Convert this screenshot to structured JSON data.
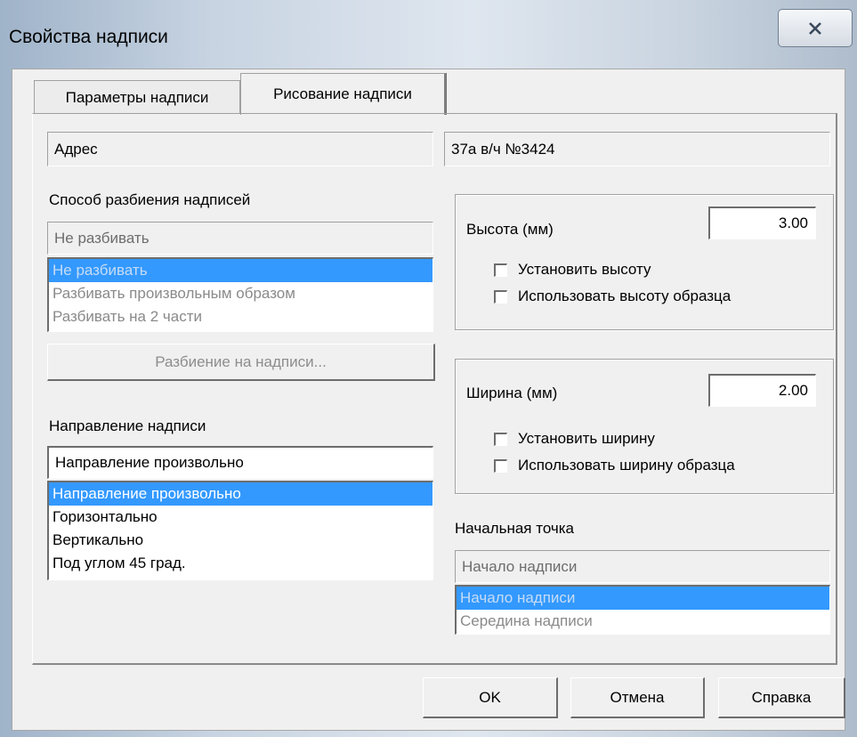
{
  "window": {
    "title": "Свойства надписи",
    "close_icon": "close-icon"
  },
  "tabs": [
    {
      "label": "Параметры надписи",
      "active": false
    },
    {
      "label": "Рисование надписи",
      "active": true
    }
  ],
  "left": {
    "field_address": "Адрес",
    "split_label": "Способ разбиения надписей",
    "split_value": "Не разбивать",
    "split_options": [
      "Не разбивать",
      "Разбивать произвольным образом",
      "Разбивать на 2 части"
    ],
    "split_button": "Разбиение на надписи...",
    "direction_label": "Направление надписи",
    "direction_value": "Направление произвольно",
    "direction_options": [
      "Направление произвольно",
      "Горизонтально",
      "Вертикально",
      "Под углом 45 град."
    ]
  },
  "right": {
    "field_value": "37а в/ч №3424",
    "height_label": "Высота (мм)",
    "height_value": "3.00",
    "height_check1": "Установить высоту",
    "height_check2": "Использовать высоту образца",
    "width_label": "Ширина (мм)",
    "width_value": "2.00",
    "width_check1": "Установить ширину",
    "width_check2": "Использовать ширину образца",
    "start_label": "Начальная точка",
    "start_value": "Начало надписи",
    "start_options": [
      "Начало надписи",
      "Середина надписи"
    ]
  },
  "buttons": {
    "ok": "OK",
    "cancel": "Отмена",
    "help": "Справка"
  },
  "colors": {
    "selection": "#3399ff",
    "dialog_bg": "#f0f0f0"
  }
}
